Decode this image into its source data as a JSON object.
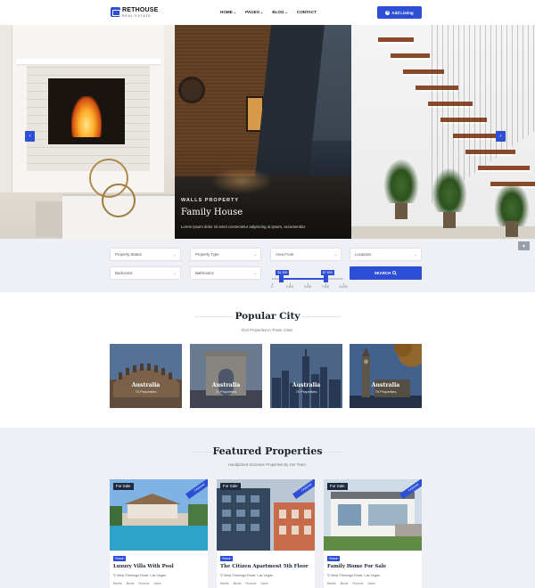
{
  "header": {
    "logo_name": "RETHOUSE",
    "logo_sub": "REAL ESTATE",
    "nav": [
      {
        "label": "HOME",
        "chevron": true
      },
      {
        "label": "PAGES",
        "chevron": true
      },
      {
        "label": "BLOG",
        "chevron": true
      },
      {
        "label": "CONTACT",
        "chevron": false
      }
    ],
    "add_listing_label": "Add Listing"
  },
  "hero": {
    "kicker": "WALLS PROPERTY",
    "title": "Family House",
    "description": "Lorem ipsum dolor sit amet consectetur adipiscing ut ipsum, accumendar.",
    "prev_icon": "chevron-left-icon",
    "next_icon": "chevron-right-icon"
  },
  "search": {
    "fields": {
      "status": "Property Status",
      "type": "Property Type",
      "area": "Area From",
      "location": "Locations",
      "bedrooms": "Bedrooms",
      "bathrooms": "Bathrooms"
    },
    "button_label": "SEARCH",
    "price": {
      "min_label": "$1 300",
      "max_label": "$7 600",
      "min_value": 1300,
      "max_value": 7600,
      "scale_max": 10000,
      "ticks": [
        "0",
        "2,500",
        "5,000",
        "7,500",
        "10,000"
      ]
    }
  },
  "popular_city": {
    "title": "Popular City",
    "subtitle": "Find Properties In These Cities.",
    "cities": [
      {
        "name": "Australia",
        "count": "70 Properties",
        "scene": "colosseum"
      },
      {
        "name": "Australia",
        "count": "70 Properties",
        "scene": "arc"
      },
      {
        "name": "Australia",
        "count": "70 Properties",
        "scene": "skyline"
      },
      {
        "name": "Australia",
        "count": "70 Properties",
        "scene": "bigben"
      }
    ]
  },
  "featured": {
    "title": "Featured Properties",
    "subtitle": "Handpicked Exclusive Properties By Our Team.",
    "properties": [
      {
        "tag": "For Sale",
        "ribbon": "Featured",
        "badge": "House",
        "name": "Luxury Villa With Pool",
        "address": "West Flamingo Road, Las Vegas",
        "features": [
          "Baths",
          "Beds",
          "Rooms",
          "Area"
        ]
      },
      {
        "tag": "For Sale",
        "ribbon": "Featured",
        "badge": "House",
        "name": "The Citizen Apartment 5th Floor",
        "address": "West Flamingo Road, Las Vegas",
        "features": [
          "Baths",
          "Beds",
          "Rooms",
          "Area"
        ]
      },
      {
        "tag": "For Sale",
        "ribbon": "Featured",
        "badge": "House",
        "name": "Family Home For Sale",
        "address": "West Flamingo Road, Las Vegas",
        "features": [
          "Baths",
          "Beds",
          "Rooms",
          "Area"
        ]
      }
    ]
  },
  "colors": {
    "accent": "#2d4fd6",
    "navy": "#1c2431",
    "section_bg": "#eef0f5"
  }
}
